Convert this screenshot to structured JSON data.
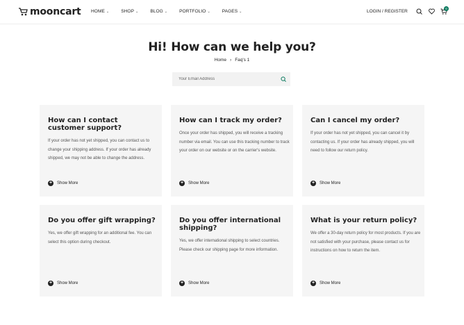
{
  "header": {
    "logo": "mooncart",
    "nav": [
      "HOME",
      "SHOP",
      "BLOG",
      "PORTFOLIO",
      "PAGES"
    ],
    "login": "LOGIN / REGISTER",
    "cart_count": "0",
    "icons": [
      "search-icon",
      "heart-icon",
      "cart-icon"
    ]
  },
  "hero": {
    "title": "Hi! How can we help you?",
    "breadcrumb": [
      "Home",
      "Faq's 1"
    ],
    "search_placeholder": "Your Email Address"
  },
  "faqs": [
    {
      "question": "How can I contact customer support?",
      "answer": "If your order has not yet shipped, you can contact us to change your shipping address. If your order has already shipped, we may not be able to change the address.",
      "more": "Show More"
    },
    {
      "question": "How can I track my order?",
      "answer": "Once your order has shipped, you will receive a tracking number via email. You can use this tracking number to track your order on our website or on the carrier's website.",
      "more": "Show More"
    },
    {
      "question": "Can I cancel my order?",
      "answer": "If your order has not yet shipped, you can cancel it by contacting us. If your order has already shipped, you will need to follow our return policy.",
      "more": "Show More"
    },
    {
      "question": "Do you offer gift wrapping?",
      "answer": "Yes, we offer gift wrapping for an additional fee. You can select this option during checkout.",
      "more": "Show More"
    },
    {
      "question": "Do you offer international shipping?",
      "answer": "Yes, we offer international shipping to select countries. Please check our shipping page for more information.",
      "more": "Show More"
    },
    {
      "question": "What is your return policy?",
      "answer": "We offer a 30-day return policy for most products. If you are not satisfied with your purchase, please contact us for instructions on how to return the item.",
      "more": "Show More"
    }
  ],
  "colors": {
    "accent": "#0b7a5e",
    "card_bg": "#f5f5f5",
    "text": "#222222"
  }
}
